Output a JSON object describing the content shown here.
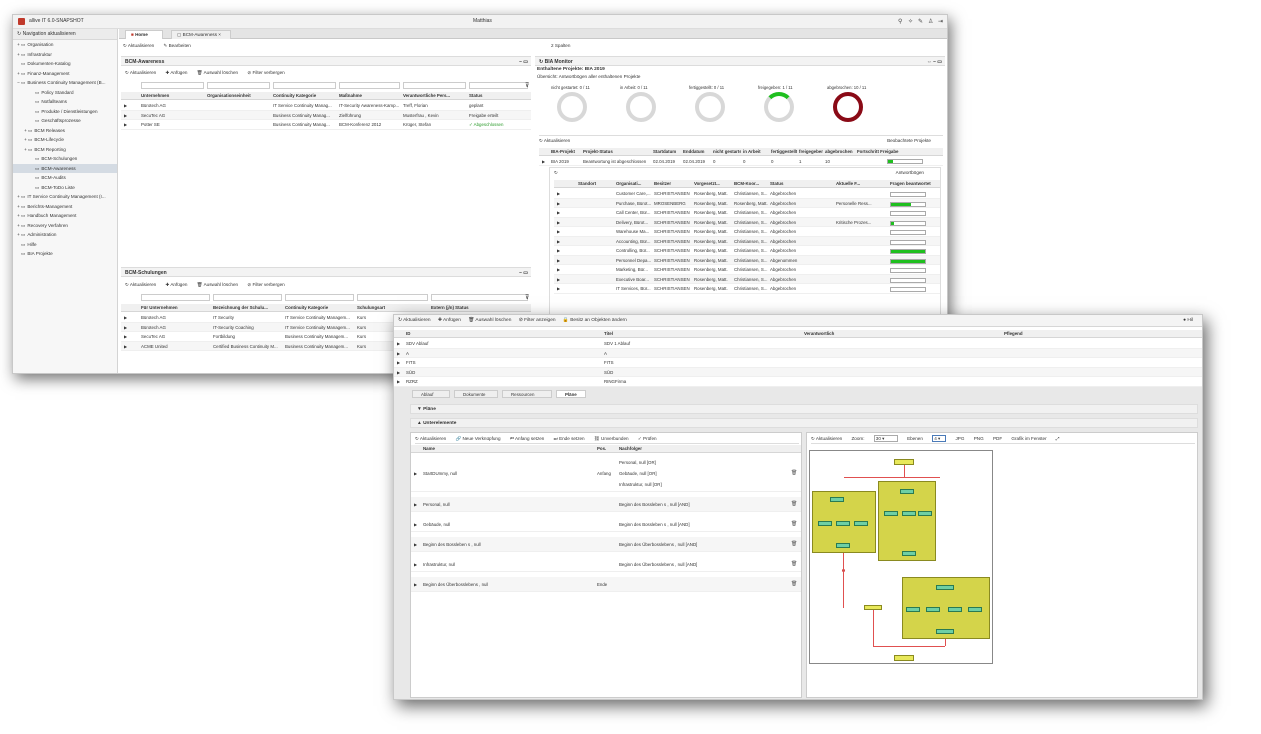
{
  "app": {
    "title": "allive IT 6.0-SNAPSHOT",
    "user": "Matthias"
  },
  "nav": {
    "header": "Navigation aktualisieren",
    "items": [
      {
        "label": "Organisation",
        "toggle": "+",
        "indent": 0
      },
      {
        "label": "Infrastruktur",
        "toggle": "+",
        "indent": 0
      },
      {
        "label": "Dokumenten-Katalog",
        "toggle": "",
        "indent": 0
      },
      {
        "label": "Finanz-Management",
        "toggle": "+",
        "indent": 0
      },
      {
        "label": "Business Continuity Management (B...",
        "toggle": "−",
        "indent": 0
      },
      {
        "label": "Policy Standard",
        "toggle": "",
        "indent": 2
      },
      {
        "label": "Notfallteams",
        "toggle": "",
        "indent": 2
      },
      {
        "label": "Produkte / Dienstleistungen",
        "toggle": "",
        "indent": 2
      },
      {
        "label": "Geschäftsprozesse",
        "toggle": "",
        "indent": 2
      },
      {
        "label": "BCM Releases",
        "toggle": "+",
        "indent": 1
      },
      {
        "label": "BCM-Lifecycle",
        "toggle": "+",
        "indent": 1
      },
      {
        "label": "BCM Reporting",
        "toggle": "+",
        "indent": 1
      },
      {
        "label": "BCM-Schulungen",
        "toggle": "",
        "indent": 2
      },
      {
        "label": "BCM-Awareness",
        "toggle": "",
        "indent": 2,
        "selected": true
      },
      {
        "label": "BCM-Audits",
        "toggle": "",
        "indent": 2
      },
      {
        "label": "BCM-ToDo Liste",
        "toggle": "",
        "indent": 2
      },
      {
        "label": "IT Service Continuity Management (I...",
        "toggle": "+",
        "indent": 0
      },
      {
        "label": "Berichts-Management",
        "toggle": "+",
        "indent": 0
      },
      {
        "label": "Handbuch Management",
        "toggle": "+",
        "indent": 0
      },
      {
        "label": "Recovery Verfahren",
        "toggle": "+",
        "indent": 0
      },
      {
        "label": "Administration",
        "toggle": "+",
        "indent": 0
      },
      {
        "label": "Hilfe",
        "toggle": "",
        "indent": 0
      },
      {
        "label": "BIA Projekte",
        "toggle": "",
        "indent": 0
      }
    ]
  },
  "tabs": [
    {
      "label": "Home"
    },
    {
      "label": "BCM-Awareness"
    }
  ],
  "toolbar": {
    "refresh": "Aktualisieren",
    "edit": "Bearbeiten",
    "columns": "2 Spalten"
  },
  "grid_toolbar": {
    "refresh": "Aktualisieren",
    "add": "Anfügen",
    "delete": "Auswahl löschen",
    "filter": "Filter verbergen"
  },
  "awareness": {
    "title": "BCM-Awareness",
    "columns": [
      "Unternehmen",
      "Organisationseinheit",
      "Continuity Kategorie",
      "Maßnahme",
      "Verantwortliche Pers...",
      "Status"
    ],
    "rows": [
      [
        "Bürotech AG",
        "",
        "IT Service Continuity Manag...",
        "IT-Security Awareness-Kamp...",
        "Treff, Florian",
        "geplant"
      ],
      [
        "SecuTec AG",
        "",
        "Business Continuity Manag...",
        "Zielführung",
        "Musterfrau , Kevin",
        "Freigabe erteilt"
      ],
      [
        "Potter SE",
        "",
        "Business Continuity Manag...",
        "BCM-Konferenz 2012",
        "Krüger, Stefan",
        "✓ Abgeschlossen"
      ]
    ]
  },
  "schulungen": {
    "title": "BCM-Schulungen",
    "columns": [
      "Für Unternehmen",
      "Bezeichnung der Schulu...",
      "Continuity Kategorie",
      "Schulungsart",
      "Extern (j/n) Status"
    ],
    "rows": [
      [
        "Bürotech AG",
        "IT Security",
        "IT Service Continuity Managem...",
        "Kurs",
        ""
      ],
      [
        "Bürotech AG",
        "IT-Security Coaching",
        "IT Service Continuity Managem...",
        "Kurs",
        ""
      ],
      [
        "SecuTec AG",
        "Fortbildung",
        "Business Continuity Managem...",
        "Kurs",
        ""
      ],
      [
        "ACME United",
        "Certified Business Continuity M...",
        "Business Continuity Managem...",
        "Kurs",
        ""
      ]
    ]
  },
  "bia": {
    "title": "BIA Monitor",
    "subtitle": "Enthaltene Projekte: BIA 2019",
    "subtitle2": "Übersicht: Antwortbögen aller enthaltenen Projekte",
    "rings": [
      {
        "label": "nicht gestartet: 0 / 11",
        "fraction": 0
      },
      {
        "label": "in Arbeit: 0 / 11",
        "fraction": 0
      },
      {
        "label": "fertiggestellt: 0 / 11",
        "fraction": 0
      },
      {
        "label": "freigegeben: 1 / 11",
        "fraction": 0.09
      },
      {
        "label": "abgebrochen: 10 / 11",
        "fraction": 0.91
      }
    ],
    "refresh": "Aktualisieren",
    "observed": "Beobachtete Projekte",
    "columns": [
      "BIA-Projekt",
      "Projekt-Status",
      "Startdatum",
      "Enddatum",
      "nicht gestartet",
      "in Arbeit",
      "fertiggestellt",
      "freigegeben",
      "abgebrochen",
      "Fortschritt Freigabe"
    ],
    "row": [
      "BIA 2019",
      "Beantwortung ist abgeschlossen",
      "02.04.2019",
      "02.04.2019",
      "0",
      "0",
      "0",
      "1",
      "10"
    ],
    "row_progress": 0.15,
    "answers_label": "Antwortbögen",
    "answer_columns": [
      "Standort",
      "Organisati...",
      "Besitzer",
      "Vorgesetzt...",
      "BCM-Koor...",
      "Status",
      "Aktuelle F...",
      "Fragen beantwortet"
    ],
    "answers": [
      [
        "",
        "Customer Care,...",
        "SCHRISTIANSEN",
        "Rosenberg, Matt.",
        "Christiansen, S...",
        "Abgebrochen",
        "",
        0
      ],
      [
        "",
        "Purchase, Bürot...",
        "MROSENBERG",
        "Rosenberg, Matt.",
        "Rosenberg, Matt.",
        "Abgebrochen",
        "Personelle Ress...",
        0.6
      ],
      [
        "",
        "Call Center, Bür...",
        "SCHRISTIANSEN",
        "Rosenberg, Matt.",
        "Christiansen, S...",
        "Abgebrochen",
        "",
        0
      ],
      [
        "",
        "Delivery, Bürot...",
        "SCHRISTIANSEN",
        "Rosenberg, Matt.",
        "Christiansen, S...",
        "Abgebrochen",
        "Kritische Prozes...",
        0.1
      ],
      [
        "",
        "Warehouse Ma...",
        "SCHRISTIANSEN",
        "Rosenberg, Matt.",
        "Christiansen, S...",
        "Abgebrochen",
        "",
        0
      ],
      [
        "",
        "Accounting, Bür...",
        "SCHRISTIANSEN",
        "Rosenberg, Matt.",
        "Christiansen, S...",
        "Abgebrochen",
        "",
        0
      ],
      [
        "",
        "Controlling, Bür...",
        "SCHRISTIANSEN",
        "Rosenberg, Matt.",
        "Christiansen, S...",
        "Abgebrochen",
        "",
        1
      ],
      [
        "",
        "Personnel Depa...",
        "SCHRISTIANSEN",
        "Rosenberg, Matt.",
        "Christiansen, S...",
        "Abgenommen",
        "",
        1
      ],
      [
        "",
        "Marketing, Bür...",
        "SCHRISTIANSEN",
        "Rosenberg, Matt.",
        "Christiansen, S...",
        "Abgebrochen",
        "",
        0
      ],
      [
        "",
        "Executive Boar...",
        "SCHRISTIANSEN",
        "Rosenberg, Matt.",
        "Christiansen, S...",
        "Abgebrochen",
        "",
        0
      ],
      [
        "",
        "IT Services, Bür...",
        "SCHRISTIANSEN",
        "Rosenberg, Matt.",
        "Christiansen, S...",
        "Abgebrochen",
        "",
        0
      ]
    ]
  },
  "w2": {
    "toolbar": {
      "refresh": "Aktualisieren",
      "add": "Anfügen",
      "delete": "Auswahl löschen",
      "filter": "Filter anzeigen",
      "owner": "Besitz an Objekten ändern",
      "help": "Hil"
    },
    "columns": [
      "ID",
      "Titel",
      "Verantwortlich",
      "Pflegend"
    ],
    "rows": [
      [
        "SDV Ablauf",
        "SDV 1 Ablauf"
      ],
      [
        "A",
        "A"
      ],
      [
        "FITS",
        "FITS"
      ],
      [
        "SÜD",
        "SÜD"
      ],
      [
        "RZRZ",
        "RINGFirma"
      ]
    ],
    "subtabs": [
      "Ablauf",
      "Dokumente",
      "Ressourcen",
      "Pläne"
    ],
    "sec_plaene": "Pläne",
    "sec_unter": "Unterelemente",
    "left_tb": {
      "refresh": "Aktualisieren",
      "link": "Neue Verknüpfung",
      "start": "Anfang setzen",
      "end": "Ende setzen",
      "unlinked": "Unverbunden",
      "check": "Prüfen"
    },
    "left_cols": [
      "Name",
      "Pos.",
      "Nachfolger"
    ],
    "left_rows": [
      {
        "name": "StartDUmmy, null",
        "pos": "Anfang",
        "succ": [
          "Personal, null [OR]",
          "Gebäude, null [OR]",
          "Infrastruktur, null [OR]"
        ]
      },
      {
        "name": "Personal, null",
        "pos": "",
        "succ": [
          "Beginn des Bossleben s , null [AND]"
        ]
      },
      {
        "name": "Gebäude, null",
        "pos": "",
        "succ": [
          "Beginn des Bossleben s , null [AND]"
        ]
      },
      {
        "name": "Beginn des Bossleben s , null",
        "pos": "",
        "succ": [
          "Beginn des Überbosslebens , null [AND]"
        ]
      },
      {
        "name": "Infrastruktur, null",
        "pos": "",
        "succ": [
          "Beginn des Überbosslebens , null [AND]"
        ]
      },
      {
        "name": "Beginn des Überbosslebens , null",
        "pos": "Ende",
        "succ": []
      }
    ],
    "right_tb": {
      "refresh": "Aktualisieren",
      "zoom_label": "Zoom:",
      "zoom": "30",
      "levels_label": "Ebenen",
      "levels": "4",
      "jpg": "JPG",
      "png": "PNG",
      "pdf": "PDF",
      "window": "Grafik im Fenster"
    }
  }
}
